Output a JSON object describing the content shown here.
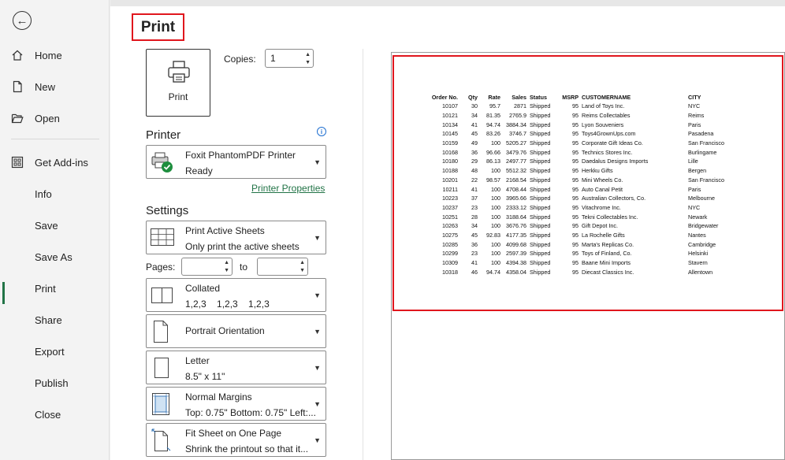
{
  "nav": {
    "items": [
      {
        "label": "Home"
      },
      {
        "label": "New"
      },
      {
        "label": "Open"
      },
      {
        "label": "Get Add-ins"
      },
      {
        "label": "Info"
      },
      {
        "label": "Save"
      },
      {
        "label": "Save As"
      },
      {
        "label": "Print"
      },
      {
        "label": "Share"
      },
      {
        "label": "Export"
      },
      {
        "label": "Publish"
      },
      {
        "label": "Close"
      }
    ],
    "active": "Print"
  },
  "header": {
    "title": "Print"
  },
  "print_button": {
    "label": "Print"
  },
  "copies": {
    "label": "Copies:",
    "value": "1"
  },
  "printer": {
    "heading": "Printer",
    "name": "Foxit PhantomPDF Printer",
    "status": "Ready",
    "properties_link": "Printer Properties"
  },
  "settings": {
    "heading": "Settings",
    "scope": {
      "title": "Print Active Sheets",
      "subtitle": "Only print the active sheets"
    },
    "pages": {
      "label": "Pages:",
      "to_label": "to",
      "from": "",
      "to": ""
    },
    "collation": {
      "title": "Collated",
      "subtitle": "1,2,3    1,2,3    1,2,3"
    },
    "orientation": {
      "title": "Portrait Orientation"
    },
    "paper": {
      "title": "Letter",
      "subtitle": "8.5\" x 11\""
    },
    "margins": {
      "title": "Normal Margins",
      "subtitle": "Top: 0.75\" Bottom: 0.75\" Left:..."
    },
    "scaling": {
      "title": "Fit Sheet on One Page",
      "subtitle": "Shrink the printout so that it..."
    }
  },
  "preview": {
    "headers": [
      "Order No.",
      "Qty",
      "Rate",
      "Sales",
      "Status",
      "MSRP",
      "CUSTOMERNAME",
      "CITY"
    ],
    "rows": [
      [
        "10107",
        "30",
        "95.7",
        "2871",
        "Shipped",
        "95",
        "Land of Toys Inc.",
        "NYC"
      ],
      [
        "10121",
        "34",
        "81.35",
        "2765.9",
        "Shipped",
        "95",
        "Reims Collectables",
        "Reims"
      ],
      [
        "10134",
        "41",
        "94.74",
        "3884.34",
        "Shipped",
        "95",
        "Lyon Souveniers",
        "Paris"
      ],
      [
        "10145",
        "45",
        "83.26",
        "3746.7",
        "Shipped",
        "95",
        "Toys4GrownUps.com",
        "Pasadena"
      ],
      [
        "10159",
        "49",
        "100",
        "5205.27",
        "Shipped",
        "95",
        "Corporate Gift Ideas Co.",
        "San Francisco"
      ],
      [
        "10168",
        "36",
        "96.66",
        "3479.76",
        "Shipped",
        "95",
        "Technics Stores Inc.",
        "Burlingame"
      ],
      [
        "10180",
        "29",
        "86.13",
        "2497.77",
        "Shipped",
        "95",
        "Daedalus Designs Imports",
        "Lille"
      ],
      [
        "10188",
        "48",
        "100",
        "5512.32",
        "Shipped",
        "95",
        "Herkku Gifts",
        "Bergen"
      ],
      [
        "10201",
        "22",
        "98.57",
        "2168.54",
        "Shipped",
        "95",
        "Mini Wheels Co.",
        "San Francisco"
      ],
      [
        "10211",
        "41",
        "100",
        "4708.44",
        "Shipped",
        "95",
        "Auto Canal Petit",
        "Paris"
      ],
      [
        "10223",
        "37",
        "100",
        "3965.66",
        "Shipped",
        "95",
        "Australian Collectors, Co.",
        "Melbourne"
      ],
      [
        "10237",
        "23",
        "100",
        "2333.12",
        "Shipped",
        "95",
        "Vitachrome Inc.",
        "NYC"
      ],
      [
        "10251",
        "28",
        "100",
        "3188.64",
        "Shipped",
        "95",
        "Tekni Collectables Inc.",
        "Newark"
      ],
      [
        "10263",
        "34",
        "100",
        "3676.76",
        "Shipped",
        "95",
        "Gift Depot Inc.",
        "Bridgewater"
      ],
      [
        "10275",
        "45",
        "92.83",
        "4177.35",
        "Shipped",
        "95",
        "La Rochelle Gifts",
        "Nantes"
      ],
      [
        "10285",
        "36",
        "100",
        "4099.68",
        "Shipped",
        "95",
        "Marta's Replicas Co.",
        "Cambridge"
      ],
      [
        "10299",
        "23",
        "100",
        "2597.39",
        "Shipped",
        "95",
        "Toys of Finland, Co.",
        "Helsinki"
      ],
      [
        "10309",
        "41",
        "100",
        "4394.38",
        "Shipped",
        "95",
        "Baane Mini Imports",
        "Stavern"
      ],
      [
        "10318",
        "46",
        "94.74",
        "4358.04",
        "Shipped",
        "95",
        "Diecast Classics Inc.",
        "Allentown"
      ]
    ]
  },
  "colors": {
    "accent": "#217346",
    "highlight": "#e0161d",
    "info": "#1f6fd0"
  }
}
